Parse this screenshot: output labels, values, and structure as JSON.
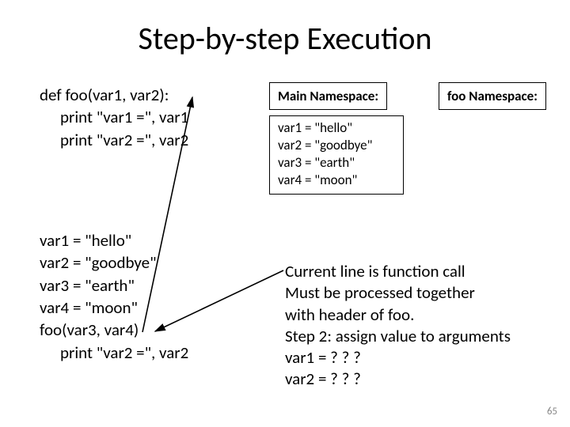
{
  "title": "Step-by-step Execution",
  "code_top": {
    "l1": "def foo(var1, var2):",
    "l2": "print \"var1 =\", var1",
    "l3": "print \"var2 =\", var2"
  },
  "code_bottom": {
    "l1": "var1 = \"hello\"",
    "l2": "var2 = \"goodbye\"",
    "l3": "var3 = \"earth\"",
    "l4": "var4 = \"moon\"",
    "l5": "foo(var3, var4)",
    "l6": "print \"var2 =\", var2"
  },
  "main_ns_label": "Main Namespace:",
  "foo_ns_label": "foo Namespace:",
  "main_ns_vars": {
    "l1": "var1 = \"hello\"",
    "l2": "var2 = \"goodbye\"",
    "l3": "var3 = \"earth\"",
    "l4": "var4 = \"moon\""
  },
  "explain": {
    "l1": "Current line is function call",
    "l2": "Must be processed together",
    "l3": "with header of foo.",
    "l4": "Step 2: assign value to arguments",
    "l5": "var1 = ? ? ?",
    "l6": "var2 = ? ? ?"
  },
  "page_number": "65"
}
